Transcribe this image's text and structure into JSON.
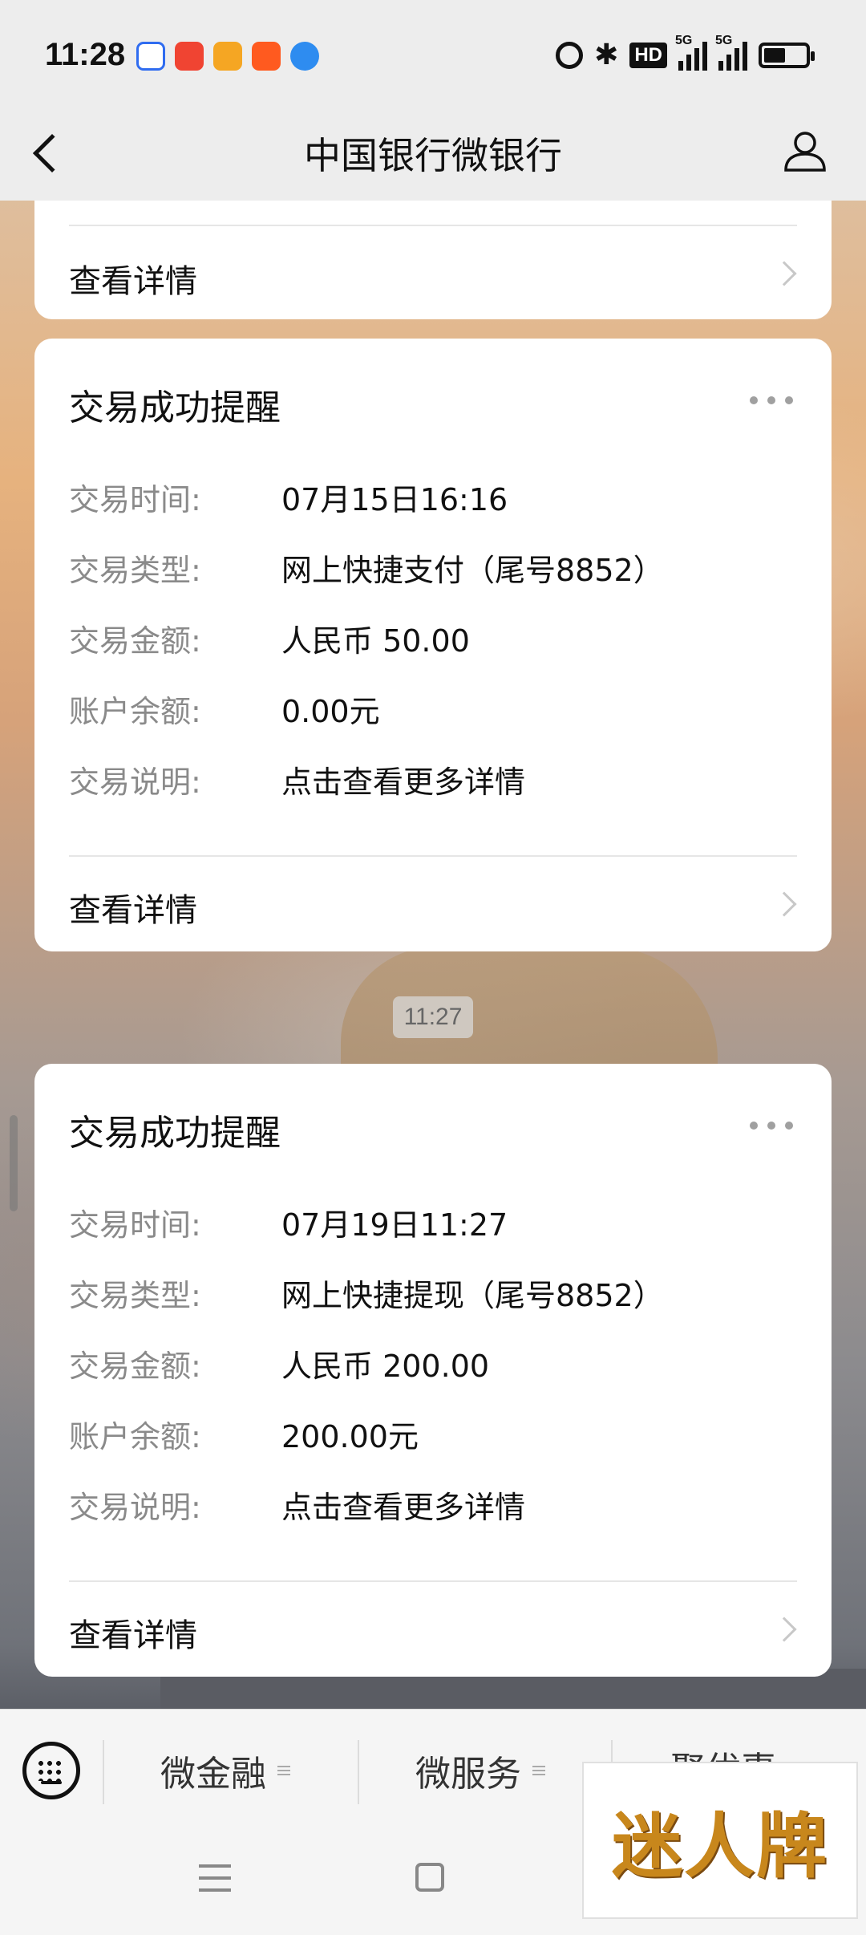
{
  "status_bar": {
    "time": "11:28",
    "app_icons": [
      {
        "name": "baidu-app-icon",
        "color": "#2f6cf0"
      },
      {
        "name": "video-app-icon",
        "color": "#f04432"
      },
      {
        "name": "tv-app-icon",
        "color": "#f5a623"
      },
      {
        "name": "kuaishou-app-icon",
        "color": "#ff5a1f"
      },
      {
        "name": "browser-app-icon",
        "color": "#2e8cf0"
      }
    ],
    "hd_label": "HD",
    "signal_tags": [
      "5G",
      "5G"
    ]
  },
  "nav": {
    "title": "中国银行微银行"
  },
  "top_card": {
    "detail_label": "查看详情"
  },
  "cards": [
    {
      "title": "交易成功提醒",
      "rows": [
        {
          "label": "交易时间:",
          "value": "07月15日16:16"
        },
        {
          "label": "交易类型:",
          "value": "网上快捷支付（尾号8852）"
        },
        {
          "label": "交易金额:",
          "value": "人民币 50.00"
        },
        {
          "label": "账户余额:",
          "value": "0.00元"
        },
        {
          "label": "交易说明:",
          "value": "点击查看更多详情"
        }
      ],
      "detail_label": "查看详情"
    },
    {
      "title": "交易成功提醒",
      "rows": [
        {
          "label": "交易时间:",
          "value": "07月19日11:27"
        },
        {
          "label": "交易类型:",
          "value": "网上快捷提现（尾号8852）"
        },
        {
          "label": "交易金额:",
          "value": "人民币 200.00"
        },
        {
          "label": "账户余额:",
          "value": "200.00元"
        },
        {
          "label": "交易说明:",
          "value": "点击查看更多详情"
        }
      ],
      "detail_label": "查看详情"
    }
  ],
  "timestamp": "11:27",
  "bottom_menu": {
    "items": [
      "微金融",
      "微服务",
      "聚优惠"
    ]
  },
  "watermark": "迷人牌"
}
